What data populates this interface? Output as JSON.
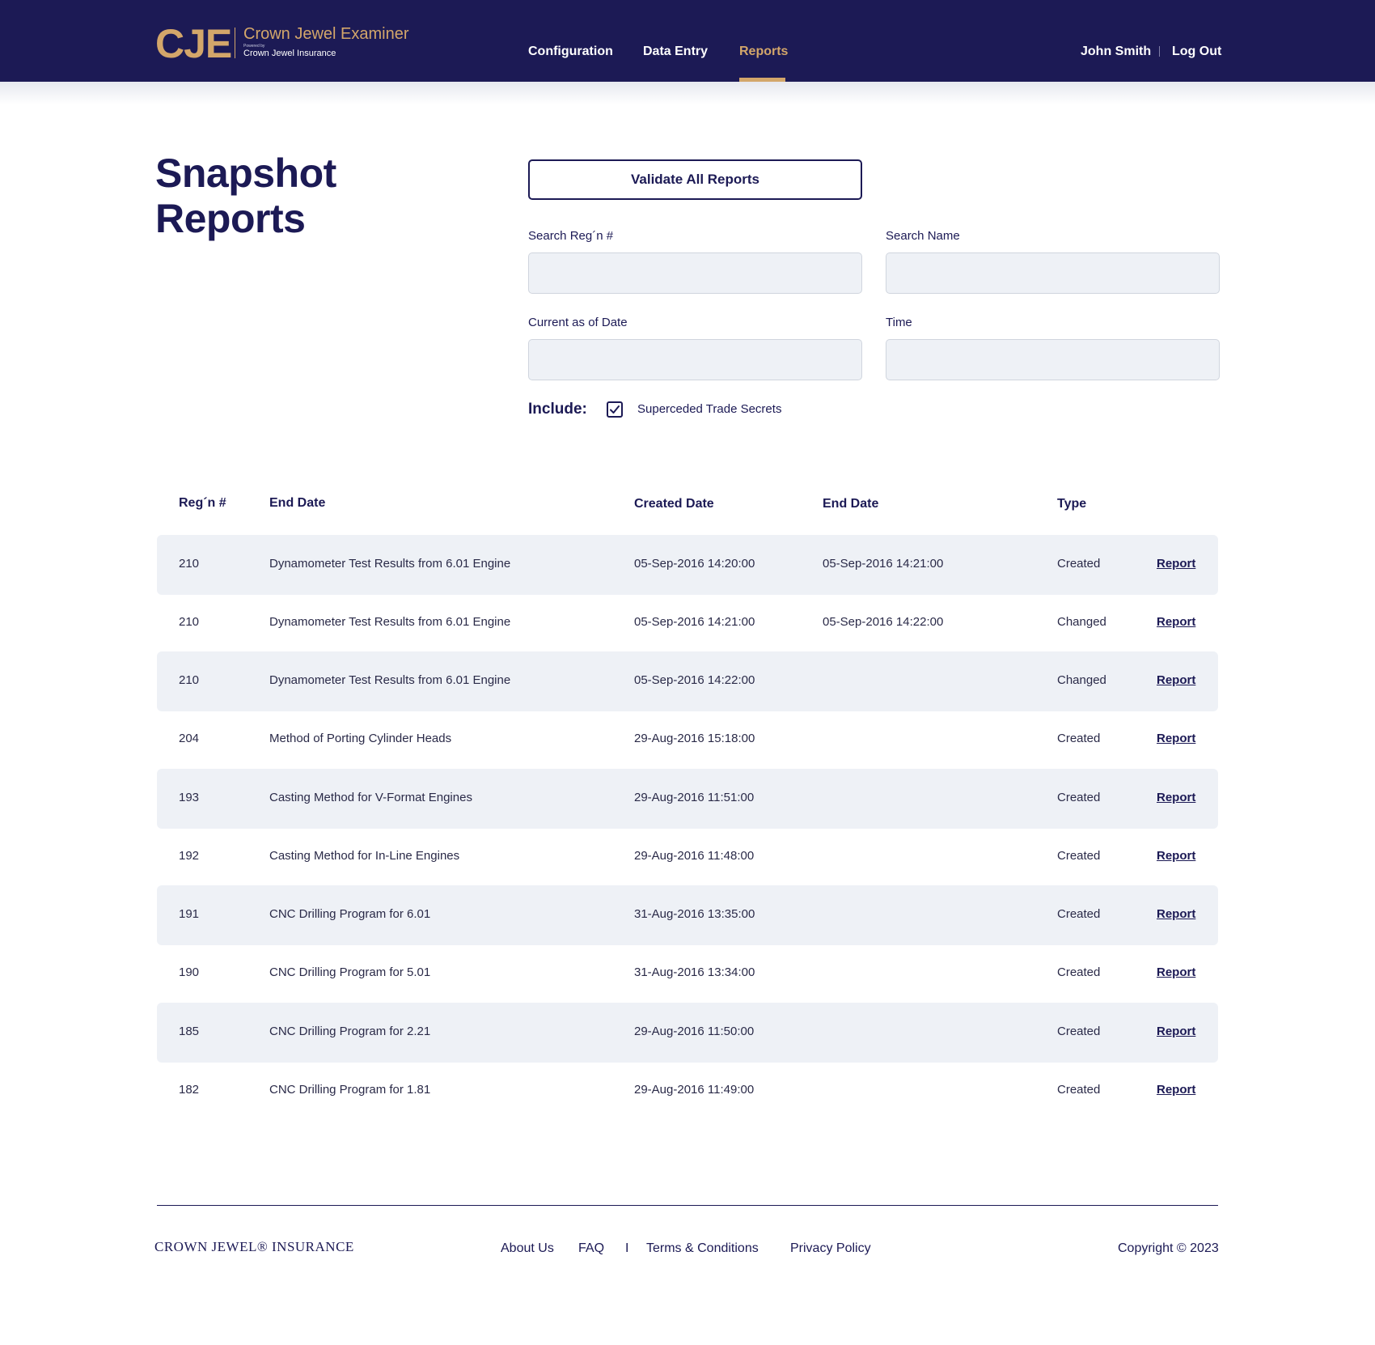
{
  "header": {
    "logo_mark": "CJE",
    "logo_title": "Crown Jewel Examiner",
    "logo_powered": "Powered by",
    "logo_sub": "Crown Jewel Insurance",
    "nav": [
      "Configuration",
      "Data Entry",
      "Reports"
    ],
    "active_nav": "Reports",
    "user_name": "John Smith",
    "logout_label": "Log Out"
  },
  "page": {
    "title": "Snapshot Reports",
    "validate_label": "Validate All Reports",
    "fields": {
      "regn": {
        "label": "Search Reg´n #",
        "value": ""
      },
      "name": {
        "label": "Search Name",
        "value": ""
      },
      "date": {
        "label": "Current as of Date",
        "value": ""
      },
      "time": {
        "label": "Time",
        "value": ""
      }
    },
    "include_label": "Include:",
    "include_option": {
      "label": "Superceded Trade Secrets",
      "checked": true
    }
  },
  "table": {
    "headers": [
      "Reg´n #",
      "End Date",
      "Created Date",
      "End Date",
      "Type"
    ],
    "rows": [
      {
        "regn": "210",
        "name": "Dynamometer Test Results from 6.01 Engine",
        "created": "05-Sep-2016 14:20:00",
        "end": "05-Sep-2016 14:21:00",
        "type": "Created",
        "link": "Report"
      },
      {
        "regn": "210",
        "name": "Dynamometer Test Results from 6.01 Engine",
        "created": "05-Sep-2016 14:21:00",
        "end": "05-Sep-2016 14:22:00",
        "type": "Changed",
        "link": "Report"
      },
      {
        "regn": "210",
        "name": "Dynamometer Test Results from 6.01 Engine",
        "created": "05-Sep-2016 14:22:00",
        "end": "",
        "type": "Changed",
        "link": "Report"
      },
      {
        "regn": "204",
        "name": "Method of Porting Cylinder Heads",
        "created": "29-Aug-2016 15:18:00",
        "end": "",
        "type": "Created",
        "link": "Report"
      },
      {
        "regn": "193",
        "name": "Casting Method for V-Format Engines",
        "created": "29-Aug-2016 11:51:00",
        "end": "",
        "type": "Created",
        "link": "Report"
      },
      {
        "regn": "192",
        "name": "Casting Method for In-Line Engines",
        "created": "29-Aug-2016 11:48:00",
        "end": "",
        "type": "Created",
        "link": "Report"
      },
      {
        "regn": "191",
        "name": "CNC Drilling Program for 6.01",
        "created": "31-Aug-2016 13:35:00",
        "end": "",
        "type": "Created",
        "link": "Report"
      },
      {
        "regn": "190",
        "name": "CNC Drilling Program for 5.01",
        "created": "31-Aug-2016 13:34:00",
        "end": "",
        "type": "Created",
        "link": "Report"
      },
      {
        "regn": "185",
        "name": "CNC Drilling Program for 2.21",
        "created": "29-Aug-2016 11:50:00",
        "end": "",
        "type": "Created",
        "link": "Report"
      },
      {
        "regn": "182",
        "name": "CNC Drilling Program for 1.81",
        "created": "29-Aug-2016 11:49:00",
        "end": "",
        "type": "Created",
        "link": "Report"
      }
    ]
  },
  "footer": {
    "brand": "CROWN JEWEL® INSURANCE",
    "links": [
      "About Us",
      "FAQ",
      "Terms & Conditions",
      "Privacy Policy"
    ],
    "separator": "I",
    "copyright": "Copyright © 2023"
  },
  "colors": {
    "navy": "#1c1a55",
    "gold": "#d3a66a",
    "row_shade": "#eef1f6"
  },
  "icons": {
    "checkbox": "check-icon"
  }
}
